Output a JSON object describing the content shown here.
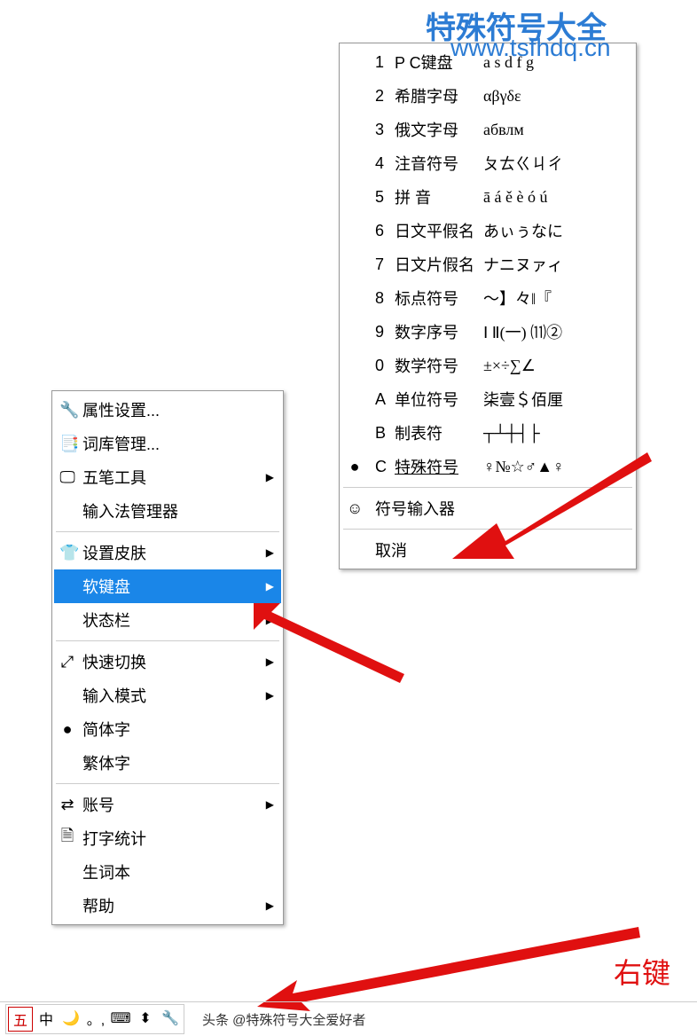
{
  "watermark": {
    "title": "特殊符号大全",
    "url": "www.tsfhdq.cn"
  },
  "menu1": {
    "items": [
      {
        "icon": "🔧",
        "label": "属性设置...",
        "sub": false
      },
      {
        "icon": "📑",
        "label": "词库管理...",
        "sub": false
      },
      {
        "icon": "🖵",
        "label": "五笔工具",
        "sub": true
      },
      {
        "icon": "",
        "label": "输入法管理器",
        "sub": false
      },
      {
        "sep": true
      },
      {
        "icon": "👕",
        "label": "设置皮肤",
        "sub": true
      },
      {
        "icon": "",
        "label": "软键盘",
        "sub": true,
        "selected": true
      },
      {
        "icon": "",
        "label": "状态栏",
        "sub": true
      },
      {
        "sep": true
      },
      {
        "icon": "⤢",
        "label": "快速切换",
        "sub": true
      },
      {
        "icon": "",
        "label": "输入模式",
        "sub": true
      },
      {
        "icon": "●",
        "label": "简体字",
        "sub": false
      },
      {
        "icon": "",
        "label": "繁体字",
        "sub": false
      },
      {
        "sep": true
      },
      {
        "icon": "⇄",
        "label": "账号",
        "sub": true
      },
      {
        "icon": "🗎",
        "label": "打字统计",
        "sub": false
      },
      {
        "icon": "",
        "label": "生词本",
        "sub": false
      },
      {
        "icon": "",
        "label": "帮助",
        "sub": true
      }
    ]
  },
  "menu2": {
    "items": [
      {
        "key": "1",
        "label": "P C键盘",
        "symbols": "a s d f g"
      },
      {
        "key": "2",
        "label": "希腊字母",
        "symbols": "αβγδε"
      },
      {
        "key": "3",
        "label": "俄文字母",
        "symbols": "абвлм"
      },
      {
        "key": "4",
        "label": "注音符号",
        "symbols": "ㄆㄊㄍㄐㄔ"
      },
      {
        "key": "5",
        "label": "拼    音",
        "symbols": "ā á ě è ó ú"
      },
      {
        "key": "6",
        "label": "日文平假名",
        "symbols": "あぃぅなに"
      },
      {
        "key": "7",
        "label": "日文片假名",
        "symbols": "ナニヌァィ"
      },
      {
        "key": "8",
        "label": "标点符号",
        "symbols": "～】々‖『"
      },
      {
        "key": "9",
        "label": "数字序号",
        "symbols": "Ⅰ Ⅱ(一) ⑾②"
      },
      {
        "key": "0",
        "label": "数学符号",
        "symbols": "±×÷∑∠"
      },
      {
        "key": "A",
        "label": "单位符号",
        "symbols": "柒壹＄佰厘"
      },
      {
        "key": "B",
        "label": "制表符",
        "symbols": "┬┴┼┤├"
      },
      {
        "key": "C",
        "label": "特殊符号",
        "symbols": "♀№☆♂▲♀",
        "icon": "●",
        "u": true
      },
      {
        "sep": true
      },
      {
        "icon": "☺",
        "label": "符号输入器"
      },
      {
        "sep": true
      },
      {
        "label": "取消"
      }
    ]
  },
  "statusbar": {
    "items": [
      "五",
      "中",
      "🌙",
      "。,",
      "⌨",
      "⬍",
      "🔧"
    ],
    "caption": "头条 @特殊符号大全爱好者"
  },
  "annot": {
    "right": "右键"
  }
}
